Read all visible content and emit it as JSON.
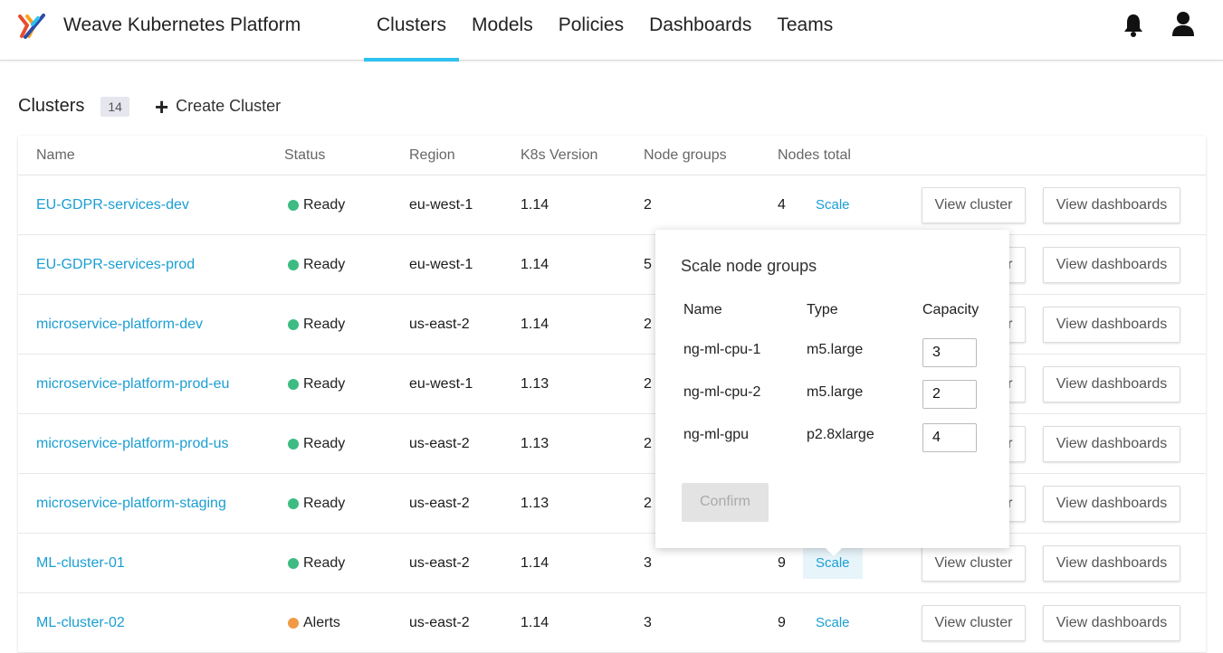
{
  "app": {
    "title": "Weave Kubernetes Platform"
  },
  "nav": [
    {
      "label": "Clusters",
      "active": true
    },
    {
      "label": "Models",
      "active": false
    },
    {
      "label": "Policies",
      "active": false
    },
    {
      "label": "Dashboards",
      "active": false
    },
    {
      "label": "Teams",
      "active": false
    }
  ],
  "header_icons": {
    "notifications": "bell-icon",
    "account": "user-icon"
  },
  "page": {
    "title": "Clusters",
    "count": "14",
    "create_label": "Create Cluster"
  },
  "table": {
    "columns": [
      "Name",
      "Status",
      "Region",
      "K8s Version",
      "Node groups",
      "Nodes total"
    ],
    "rows": [
      {
        "name": "EU-GDPR-services-dev",
        "status": "Ready",
        "region": "eu-west-1",
        "k8s": "1.14",
        "node_groups": "2",
        "nodes_total": "4"
      },
      {
        "name": "EU-GDPR-services-prod",
        "status": "Ready",
        "region": "eu-west-1",
        "k8s": "1.14",
        "node_groups": "5",
        "nodes_total": ""
      },
      {
        "name": "microservice-platform-dev",
        "status": "Ready",
        "region": "us-east-2",
        "k8s": "1.14",
        "node_groups": "2",
        "nodes_total": ""
      },
      {
        "name": "microservice-platform-prod-eu",
        "status": "Ready",
        "region": "eu-west-1",
        "k8s": "1.13",
        "node_groups": "2",
        "nodes_total": ""
      },
      {
        "name": "microservice-platform-prod-us",
        "status": "Ready",
        "region": "us-east-2",
        "k8s": "1.13",
        "node_groups": "2",
        "nodes_total": ""
      },
      {
        "name": "microservice-platform-staging",
        "status": "Ready",
        "region": "us-east-2",
        "k8s": "1.13",
        "node_groups": "2",
        "nodes_total": ""
      },
      {
        "name": "ML-cluster-01",
        "status": "Ready",
        "region": "us-east-2",
        "k8s": "1.14",
        "node_groups": "3",
        "nodes_total": "9"
      },
      {
        "name": "ML-cluster-02",
        "status": "Alerts",
        "region": "us-east-2",
        "k8s": "1.14",
        "node_groups": "3",
        "nodes_total": "9"
      }
    ],
    "scale_label": "Scale",
    "view_cluster_label": "View cluster",
    "view_dashboards_label": "View dashboards"
  },
  "status_colors": {
    "Ready": "#3dbb82",
    "Alerts": "#f09a48"
  },
  "popover": {
    "title": "Scale node groups",
    "headers": {
      "name": "Name",
      "type": "Type",
      "capacity": "Capacity"
    },
    "groups": [
      {
        "name": "ng-ml-cpu-1",
        "type": "m5.large",
        "capacity": "3"
      },
      {
        "name": "ng-ml-cpu-2",
        "type": "m5.large",
        "capacity": "2"
      },
      {
        "name": "ng-ml-gpu",
        "type": "p2.8xlarge",
        "capacity": "4"
      }
    ],
    "confirm_label": "Confirm"
  },
  "colors": {
    "accent": "#2ec1f0",
    "link": "#1b9ed2"
  }
}
